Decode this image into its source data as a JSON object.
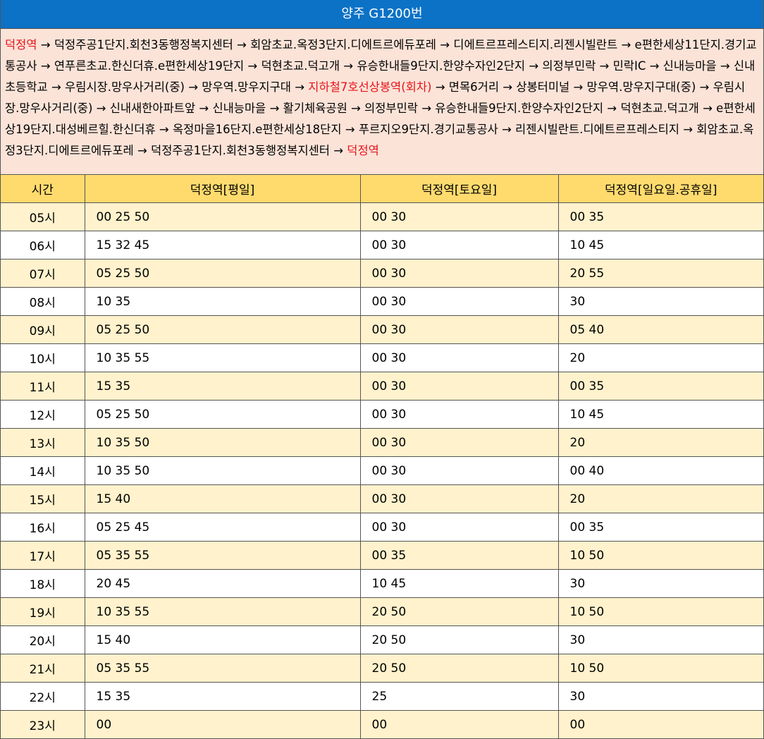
{
  "title": "양주 G1200번",
  "route": [
    {
      "text": "덕정역",
      "red": true
    },
    {
      "text": " → 덕정주공1단지.회천3동행정복지센터 → 회암초교.옥정3단지.디에트르에듀포레 → 디에트르프레스티지.리젠시빌란트 → e편한세상11단지.경기교통공사 → 연푸른초교.한신더휴.e편한세상19단지 → 덕현초교.덕고개 → 유승한내들9단지.한양수자인2단지 → 의정부민락 → 민락IC → 신내능마을 → 신내초등학교 → 우림시장.망우사거리(중) → 망우역.망우지구대 → ",
      "red": false
    },
    {
      "text": "지하철7호선상봉역(회차)",
      "red": true
    },
    {
      "text": " → 면목6거리 → 상봉터미널 → 망우역.망우지구대(중) → 우림시장.망우사거리(중) → 신내새한아파트앞 → 신내능마을 → 활기체육공원 → 의정부민락 → 유승한내들9단지.한양수자인2단지 → 덕현초교.덕고개 → e편한세상19단지.대성베르힐.한신더휴 → 옥정마을16단지.e편한세상18단지 → 푸르지오9단지.경기교통공사 → 리젠시빌란트.디에트르프레스티지 → 회암초교.옥정3단지.디에트르에듀포레 → 덕정주공1단지.회천3동행정복지센터 → ",
      "red": false
    },
    {
      "text": "덕정역",
      "red": true
    }
  ],
  "table": {
    "headers": [
      "시간",
      "덕정역[평일]",
      "덕정역[토요일]",
      "덕정역[일요일.공휴일]"
    ],
    "rows": [
      [
        "05시",
        "00 25 50",
        "00 30",
        "00 35"
      ],
      [
        "06시",
        "15 32 45",
        "00 30",
        "10 45"
      ],
      [
        "07시",
        "05 25 50",
        "00 30",
        "20 55"
      ],
      [
        "08시",
        "10 35",
        "00 30",
        "30"
      ],
      [
        "09시",
        "05 25 50",
        "00 30",
        "05 40"
      ],
      [
        "10시",
        "10 35 55",
        "00 30",
        "20"
      ],
      [
        "11시",
        "15 35",
        "00 30",
        "00 35"
      ],
      [
        "12시",
        "05 25 50",
        "00 30",
        "10 45"
      ],
      [
        "13시",
        "10 35 50",
        "00 30",
        "20"
      ],
      [
        "14시",
        "10 35 50",
        "00 30",
        "00 40"
      ],
      [
        "15시",
        "15 40",
        "00 30",
        "20"
      ],
      [
        "16시",
        "05 25 45",
        "00 30",
        "00 35"
      ],
      [
        "17시",
        "05 35 55",
        "00 35",
        "10 50"
      ],
      [
        "18시",
        "20 45",
        "10 45",
        "30"
      ],
      [
        "19시",
        "10 35 55",
        "20 50",
        "10 50"
      ],
      [
        "20시",
        "15 40",
        "20 50",
        "30"
      ],
      [
        "21시",
        "05 35 55",
        "20 50",
        "10 50"
      ],
      [
        "22시",
        "15 35",
        "25",
        "30"
      ],
      [
        "23시",
        "00",
        "00",
        "00"
      ]
    ]
  },
  "colors": {
    "title_bg": "#0b72c6",
    "route_bg": "#fbe3d8",
    "header_bg": "#ffdb6e",
    "odd_row_bg": "#fff2cc",
    "highlight_text": "#e8141b"
  }
}
